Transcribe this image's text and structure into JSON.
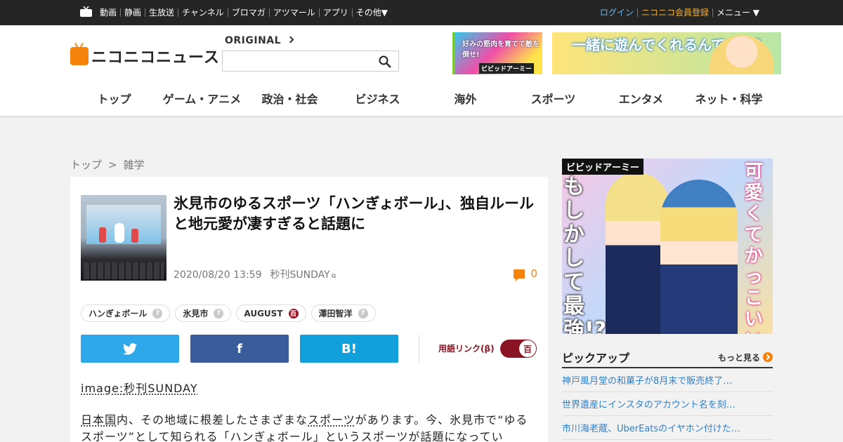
{
  "topbar": {
    "services": [
      "動画",
      "静画",
      "生放送",
      "チャンネル",
      "ブロマガ",
      "アツマール",
      "アプリ",
      "その他▼"
    ],
    "login": "ログイン",
    "register": "ニコニコ会員登録",
    "menu": "メニュー ▼"
  },
  "header": {
    "logo_text": "ニコニコニュース",
    "original_label": "ORIGINAL",
    "search_placeholder": "",
    "ad_left_text": "好みの筋肉を育てて敵を倒せ!",
    "ad_left_brand": "ビビッドアーミー",
    "ad_right_text": "一緒に遊んでくれるんですか?"
  },
  "nav": [
    "トップ",
    "ゲーム・アニメ",
    "政治・社会",
    "ビジネス",
    "海外",
    "スポーツ",
    "エンタメ",
    "ネット・科学"
  ],
  "breadcrumb": {
    "home": "トップ",
    "sep": ">",
    "category": "雑学"
  },
  "article": {
    "title": "氷見市のゆるスポーツ「ハンぎょボール」、独自ルールと地元愛が凄すぎると話題に",
    "date": "2020/08/20 13:59",
    "source": "秒刊SUNDAY",
    "comment_count": "0",
    "tags": [
      {
        "label": "ハンぎょボール",
        "badge": "?"
      },
      {
        "label": "氷見市",
        "badge": "?"
      },
      {
        "label": "AUGUST",
        "badge": "百"
      },
      {
        "label": "澤田智洋",
        "badge": "?"
      }
    ],
    "share": {
      "twitter": "t",
      "facebook": "f",
      "hatena": "B!"
    },
    "term_link_label": "用語リンク(β)",
    "term_link_badge": "百",
    "image_credit_prefix": "image:",
    "image_credit": "秒刊SUNDAY",
    "para_1_link1": "日本国",
    "para_1_a": "内、その地域に根差したさまざまな",
    "para_1_link2": "スポーツ",
    "para_1_b": "があります。今、氷見市で“ゆるスポーツ”として知られる「ハンぎょボール」というスポーツが話題になってい"
  },
  "sidebar": {
    "ad_brand": "ビビッドアーミー",
    "ad_text_left": "もしかして最強!?",
    "ad_text_right": "可愛くてかっこいいなんて",
    "pickup_title": "ピックアップ",
    "pickup_more": "もっと見る",
    "pickup_items": [
      "神戸風月堂の和菓子が8月末で販売終了…",
      "世界遺産にインスタのアカウント名を刻…",
      "市川海老蔵、UberEatsのイヤホン付けた…"
    ]
  },
  "colors": {
    "accent": "#f5820b",
    "twitter": "#2ea7eb",
    "facebook": "#3b5c9b",
    "hatena": "#12a0dc",
    "term_link": "#8a1423",
    "link": "#2e7fc9"
  }
}
